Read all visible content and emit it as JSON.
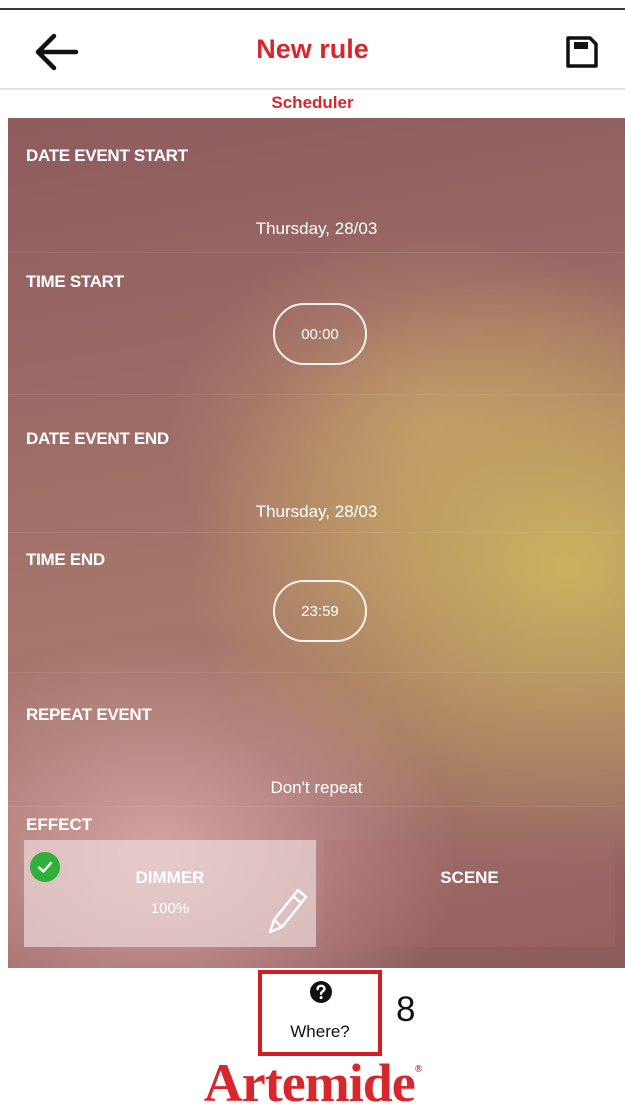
{
  "header": {
    "title": "New rule",
    "subtitle": "Scheduler",
    "back_icon": "arrow-left-icon",
    "save_icon": "floppy-disk-icon"
  },
  "sections": {
    "date_start": {
      "label": "DATE EVENT START",
      "value": "Thursday, 28/03"
    },
    "time_start": {
      "label": "TIME START",
      "value": "00:00"
    },
    "date_end": {
      "label": "DATE EVENT END",
      "value": "Thursday, 28/03"
    },
    "time_end": {
      "label": "TIME END",
      "value": "23:59"
    },
    "repeat": {
      "label": "REPEAT EVENT",
      "value": "Don't repeat"
    }
  },
  "effect": {
    "label": "EFFECT",
    "dimmer": {
      "title": "DIMMER",
      "value": "100%",
      "selected": true,
      "icons": [
        "check-icon",
        "pencil-icon"
      ]
    },
    "scene": {
      "title": "SCENE"
    }
  },
  "help": {
    "label": "Where?",
    "icon": "question-circle-icon"
  },
  "step_number": "8",
  "brand": {
    "name": "Artemide",
    "mark": "®"
  },
  "colors": {
    "accent": "#d8262d",
    "selected_check": "#2eb03b",
    "highlight_box": "#d01e24"
  }
}
